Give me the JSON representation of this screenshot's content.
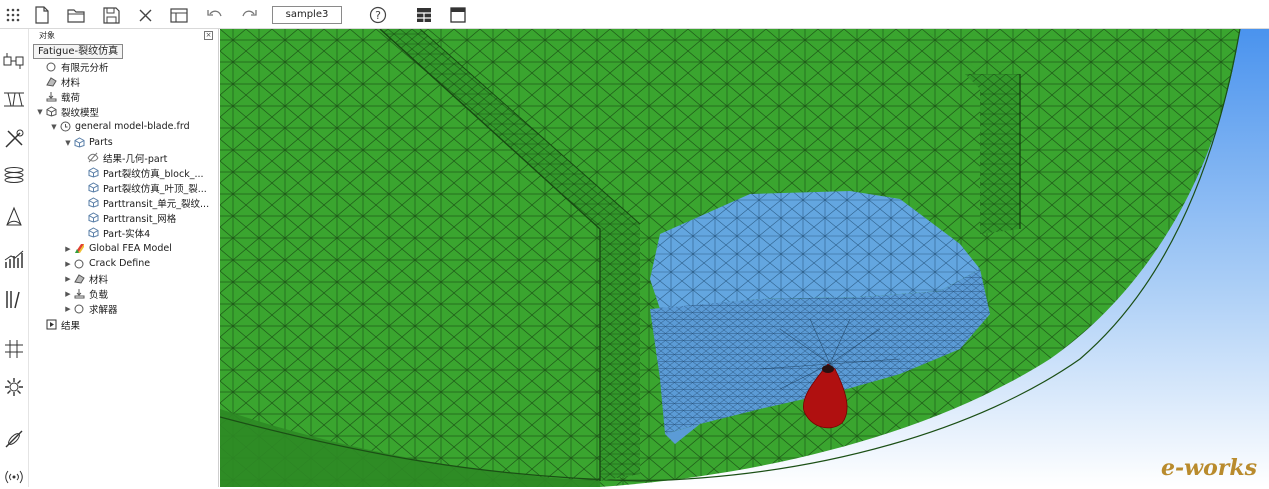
{
  "toolbar": {
    "document_name": "sample3",
    "icons": [
      "grid-menu-icon",
      "new-file-icon",
      "open-folder-icon",
      "save-icon",
      "close-icon",
      "layout-icon",
      "undo-icon",
      "redo-icon",
      "help-icon",
      "dashboard-icon",
      "window-icon"
    ]
  },
  "rail": {
    "icons": [
      "assembly-icon",
      "geometry-icon",
      "tools-icon",
      "coil-icon",
      "sail-icon",
      "chart-icon",
      "library-icon",
      "grid-icon",
      "gear-icon",
      "satellite-icon",
      "signal-icon"
    ]
  },
  "panel": {
    "title": "对象",
    "root": "Fatigue-裂纹仿真",
    "tree": [
      {
        "label": "有限元分析",
        "icon": "circle-icon"
      },
      {
        "label": "材料",
        "icon": "material-icon"
      },
      {
        "label": "载荷",
        "icon": "load-icon"
      },
      {
        "label": "裂纹模型",
        "icon": "cube-icon"
      },
      {
        "label": "general model-blade.frd",
        "icon": "clock-icon"
      },
      {
        "label": "Parts",
        "icon": "cube-icon"
      },
      {
        "label": "结果-几何-part",
        "icon": "hidden-part-icon"
      },
      {
        "label": "Part裂纹仿真_block_...",
        "icon": "cube-icon"
      },
      {
        "label": "Part裂纹仿真_叶顶_裂...",
        "icon": "cube-icon"
      },
      {
        "label": "Parttransit_单元_裂纹...",
        "icon": "cube-icon"
      },
      {
        "label": "Parttransit_网格",
        "icon": "cube-icon"
      },
      {
        "label": "Part-实体4",
        "icon": "cube-icon"
      },
      {
        "label": "Global FEA Model",
        "icon": "colormap-icon"
      },
      {
        "label": "Crack Define",
        "icon": "circle-icon"
      },
      {
        "label": "材料",
        "icon": "material-icon"
      },
      {
        "label": "负载",
        "icon": "load-icon"
      },
      {
        "label": "求解器",
        "icon": "circle-icon"
      },
      {
        "label": "结果",
        "icon": "result-icon"
      }
    ]
  },
  "viewport": {
    "logo_text": "e-works",
    "colors": {
      "mesh_green": "#3aa52f",
      "mesh_blue": "#5fa3de",
      "crack_red": "#b01010",
      "sky_top": "#5599ee",
      "sky_bottom": "#ffffff"
    }
  }
}
